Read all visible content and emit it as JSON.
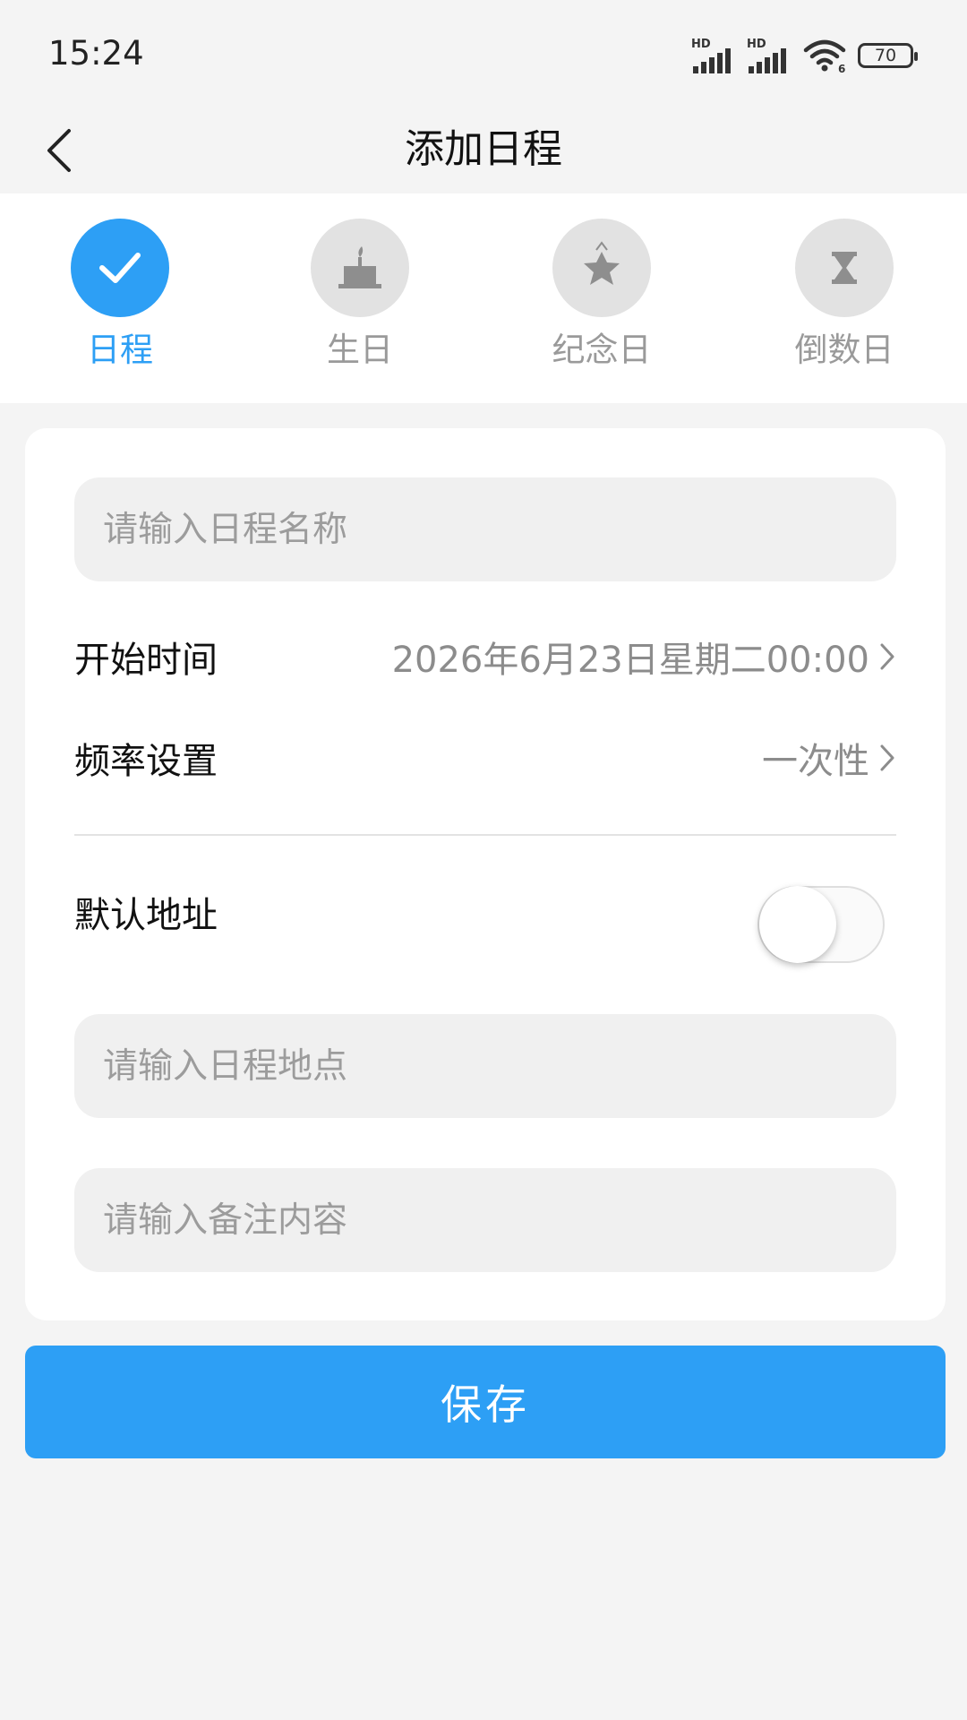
{
  "status_bar": {
    "time": "15:24",
    "signal_label_1": "HD",
    "signal_label_2": "HD",
    "wifi_label": "6",
    "battery": "70"
  },
  "header": {
    "back_icon": "chevron-left-icon",
    "title": "添加日程"
  },
  "tabs": [
    {
      "label": "日程",
      "icon": "check-icon",
      "active": true
    },
    {
      "label": "生日",
      "icon": "cake-icon",
      "active": false
    },
    {
      "label": "纪念日",
      "icon": "star-icon",
      "active": false
    },
    {
      "label": "倒数日",
      "icon": "hourglass-icon",
      "active": false
    }
  ],
  "form": {
    "name_placeholder": "请输入日程名称",
    "start_time_label": "开始时间",
    "start_time_value": "2026年6月23日星期二00:00",
    "frequency_label": "频率设置",
    "frequency_value": "一次性",
    "default_address_label": "默认地址",
    "default_address_enabled": false,
    "location_placeholder": "请输入日程地点",
    "note_placeholder": "请输入备注内容"
  },
  "save_label": "保存",
  "colors": {
    "accent": "#2d9ff5",
    "inactive_circle": "#e2e2e2",
    "inactive_icon": "#8e8e8e",
    "field_bg": "#f0f0f0",
    "page_bg": "#f4f4f4"
  }
}
